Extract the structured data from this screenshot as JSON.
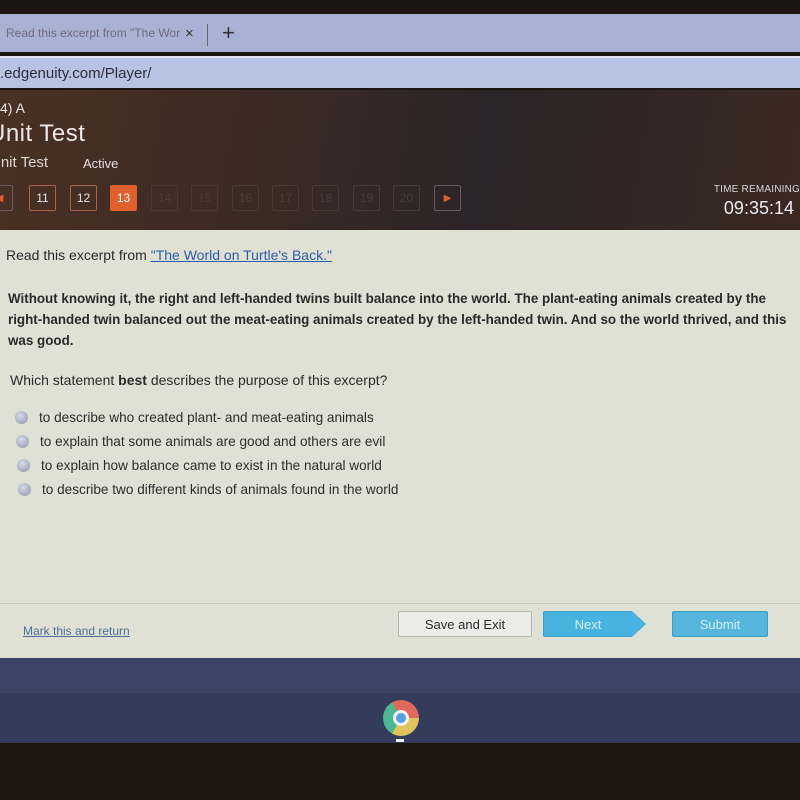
{
  "browser": {
    "tab_title": "Read this excerpt from \"The World on Turtle's Back.\"",
    "tab_close": "×",
    "new_tab": "+",
    "url": ".edgenuity.com/Player/"
  },
  "header": {
    "breadcrumb": "4) A",
    "title": "Unit Test",
    "subtitle": "Unit Test",
    "status": "Active",
    "pager": {
      "prev_icon": "◀",
      "next_icon": "▶",
      "pages": [
        {
          "label": "11",
          "state": "normal"
        },
        {
          "label": "12",
          "state": "normal"
        },
        {
          "label": "13",
          "state": "current"
        },
        {
          "label": "14",
          "state": "disabled"
        },
        {
          "label": "15",
          "state": "disabled"
        },
        {
          "label": "16",
          "state": "disabled"
        },
        {
          "label": "17",
          "state": "disabled"
        },
        {
          "label": "18",
          "state": "disabled"
        },
        {
          "label": "19",
          "state": "disabled"
        },
        {
          "label": "20",
          "state": "disabled"
        }
      ]
    },
    "time_label": "TIME REMAINING",
    "time_value": "09:35:14"
  },
  "content": {
    "intro_prefix": "Read this excerpt from ",
    "intro_link": "\"The World on Turtle's Back.\"",
    "passage": "Without knowing it, the right and left-handed twins built balance into the world. The plant-eating animals created by the right-handed twin balanced out the meat-eating animals created by the left-handed twin. And so the world thrived, and this was good.",
    "question_prefix": "Which statement ",
    "question_bold": "best",
    "question_suffix": " describes the purpose of this excerpt?",
    "options": [
      "to describe who created plant- and meat-eating animals",
      "to explain that some animals are good and others are evil",
      "to explain how balance came to exist in the natural world",
      "to describe two different kinds of animals found in the world"
    ]
  },
  "footer": {
    "mark_link": "Mark this and return",
    "save_exit": "Save and Exit",
    "next": "Next",
    "submit": "Submit"
  },
  "colors": {
    "accent_orange": "#e0602f",
    "button_blue": "#49b3e0"
  }
}
